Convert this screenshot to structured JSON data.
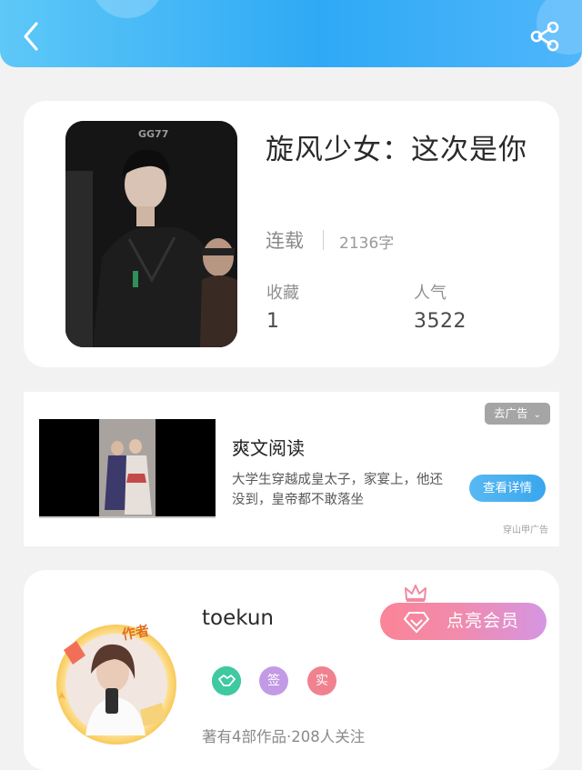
{
  "header": {
    "back_icon": "chevron-left-icon",
    "share_icon": "share-icon",
    "gradient_colors": [
      "#5ec8f7",
      "#2fa9f5",
      "#4fb6fb"
    ]
  },
  "book": {
    "title": "旋风少女：这次是你",
    "status": "连载",
    "word_count": "2136字",
    "favorites_label": "收藏",
    "favorites_value": "1",
    "popularity_label": "人气",
    "popularity_value": "3522",
    "cover_watermark": "GG77"
  },
  "ad": {
    "remove_label": "去广告",
    "title": "爽文阅读",
    "description": "大学生穿越成皇太子，家宴上，他还没到，皇帝都不敢落坐",
    "cta_label": "查看详情",
    "source": "穿山甲广告"
  },
  "author": {
    "name": "toekun",
    "avatar_tag": "作者",
    "vip_label": "点亮会员",
    "badges": [
      {
        "icon": "handshake-icon",
        "color": "#3fc9a0"
      },
      {
        "label": "签",
        "color": "#c39ae6"
      },
      {
        "label": "实",
        "color": "#f0818e"
      }
    ],
    "meta": "著有4部作品·208人关注"
  },
  "colors": {
    "accent": "#3aa6ee",
    "vip_gradient": [
      "#fb8497",
      "#d596e3"
    ]
  }
}
